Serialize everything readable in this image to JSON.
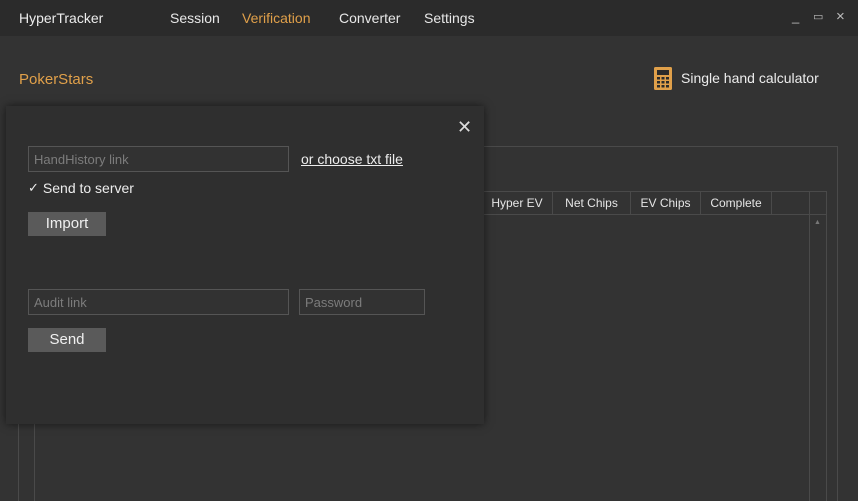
{
  "titlebar": {
    "app_title": "HyperTracker",
    "menu": [
      "Session",
      "Verification",
      "Converter",
      "Settings"
    ],
    "active_menu": "Verification",
    "window_controls": {
      "minimize": "_",
      "maximize": "▭",
      "close": "×"
    }
  },
  "header": {
    "brand": "PokerStars",
    "calculator_label": "Single hand calculator",
    "calculator_icon": "calculator-icon"
  },
  "table": {
    "columns": [
      "Hyper EV",
      "Net Chips",
      "EV Chips",
      "Complete"
    ]
  },
  "dialog": {
    "close_label": "✕",
    "handhistory_placeholder": "HandHistory link",
    "handhistory_value": "",
    "choose_file_label": "or choose txt file",
    "send_to_server_label": "Send to server",
    "send_to_server_checked": true,
    "import_label": "Import",
    "audit_placeholder": "Audit link",
    "audit_value": "",
    "password_placeholder": "Password",
    "password_value": "",
    "send_label": "Send"
  },
  "colors": {
    "accent": "#e0a04a",
    "background": "#333333",
    "dialog": "#2f2f2f",
    "button": "#5a5a5a"
  }
}
